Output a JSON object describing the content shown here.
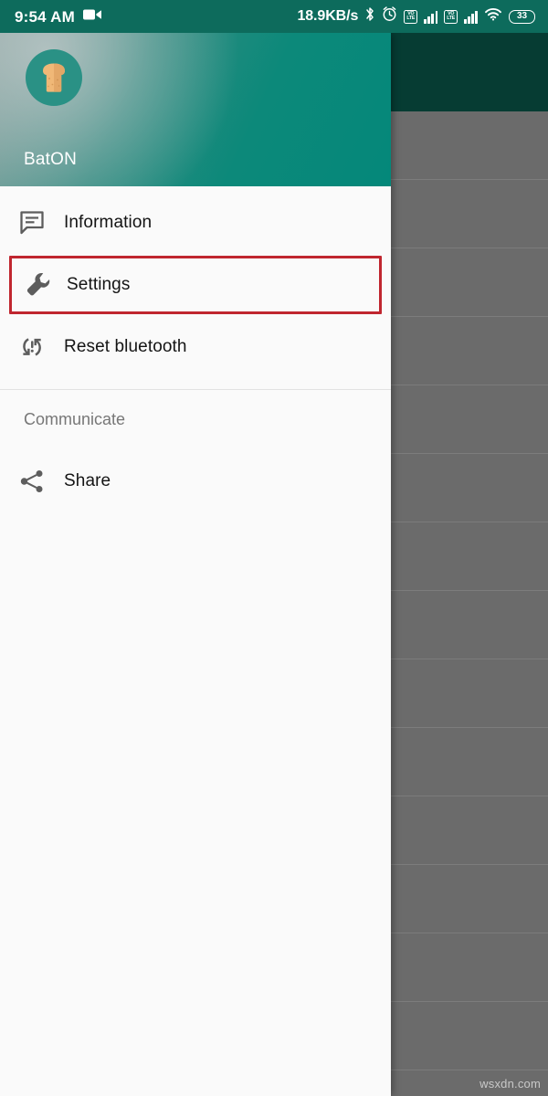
{
  "status_bar": {
    "time": "9:54 AM",
    "recording_icon": "video-camera-icon",
    "network_speed": "18.9KB/s",
    "bluetooth_icon": "bluetooth-icon",
    "alarm_icon": "alarm-clock-icon",
    "sim1": {
      "volte_top": "VO",
      "volte_bottom": "LTE",
      "signal_icon": "signal-bars-icon"
    },
    "sim2": {
      "volte_top": "VO",
      "volte_bottom": "LTE",
      "signal_icon": "signal-bars-icon"
    },
    "wifi_icon": "wifi-icon",
    "battery_level": "33",
    "background_color": "#0d6b5c"
  },
  "drawer": {
    "header": {
      "app_name": "BatON",
      "avatar_icon": "toast-bread-icon",
      "gradient_from": "#7f9c99",
      "gradient_to": "#04887a"
    },
    "items": [
      {
        "label": "Information",
        "icon": "message-info-icon",
        "highlighted": false
      },
      {
        "label": "Settings",
        "icon": "wrench-icon",
        "highlighted": true
      },
      {
        "label": "Reset bluetooth",
        "icon": "sync-problem-icon",
        "highlighted": false
      }
    ],
    "section": {
      "label": "Communicate",
      "items": [
        {
          "label": "Share",
          "icon": "share-icon",
          "highlighted": false
        }
      ]
    },
    "highlight_color": "#c0262f",
    "background_color": "#fafafa"
  },
  "background": {
    "toolbar_color": "#063c33",
    "scrim_color": "#6b6b6b",
    "row_count": 14
  },
  "watermark": "wsxdn.com"
}
